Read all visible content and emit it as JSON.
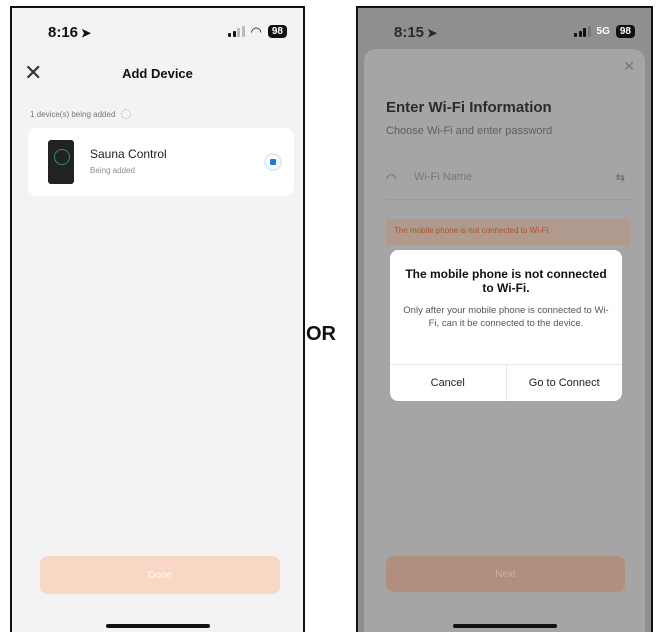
{
  "left_screen": {
    "status_bar": {
      "time": "8:16",
      "battery": "98"
    },
    "header": {
      "close_icon": "close-icon",
      "title": "Add Device"
    },
    "progress": {
      "count_text": "1 device(s) being added"
    },
    "device": {
      "name": "Sauna Control",
      "status": "Being added"
    },
    "done_button": {
      "label": "Done"
    }
  },
  "separator": {
    "label": "OR"
  },
  "right_screen": {
    "status_bar": {
      "time": "8:15",
      "network": "5G",
      "battery": "98"
    },
    "sheet": {
      "title": "Enter Wi-Fi Information",
      "subtitle": "Choose Wi-Fi and enter password",
      "wifi_field_placeholder": "Wi-Fi Name",
      "warning": "The mobile phone is not connected to Wi-Fi.",
      "next_button": "Next"
    },
    "dialog": {
      "title": "The mobile phone is not connected to Wi-Fi.",
      "message": "Only after your mobile phone is connected to Wi-Fi, can it be connected to the device.",
      "cancel": "Cancel",
      "confirm": "Go to Connect"
    }
  },
  "colors": {
    "accent_disabled": "#f8d7c4",
    "warning_text": "#b0522a",
    "progress_blue": "#1f7de1"
  }
}
